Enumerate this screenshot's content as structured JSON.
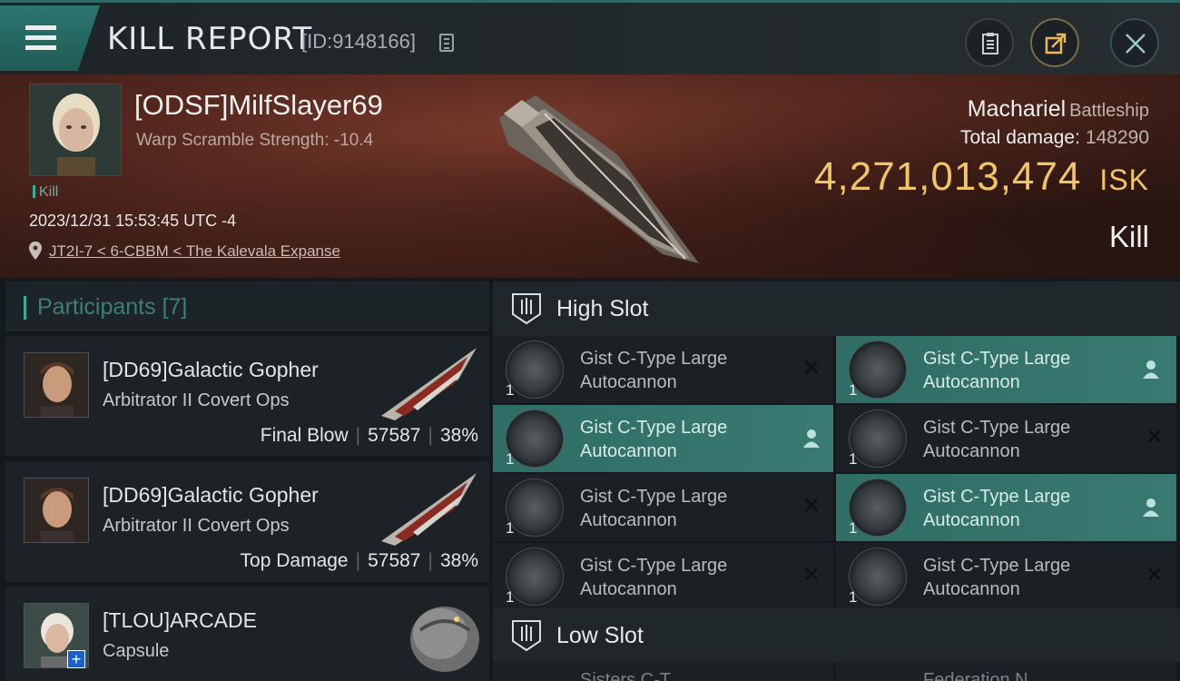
{
  "header": {
    "title": "KILL REPORT",
    "report_id": "[ID:9148166]"
  },
  "victim": {
    "name": "[ODSF]MilfSlayer69",
    "subtitle": "Warp Scramble Strength: -10.4",
    "tag": "Kill",
    "datetime": "2023/12/31 15:53:45 UTC -4",
    "location": "JT2I-7 < 6-CBBM < The Kalevala Expanse",
    "ship_name": "Machariel",
    "ship_class": "Battleship",
    "total_damage_label": "Total damage:",
    "total_damage_value": "148290",
    "isk_value": "4,271,013,474",
    "isk_unit": "ISK",
    "result": "Kill"
  },
  "participants": {
    "title": "Participants",
    "count": "[7]",
    "rows": [
      {
        "name": "[DD69]Galactic Gopher",
        "ship": "Arbitrator II Covert Ops",
        "role": "Final Blow",
        "damage": "57587",
        "percent": "38%"
      },
      {
        "name": "[DD69]Galactic Gopher",
        "ship": "Arbitrator II Covert Ops",
        "role": "Top Damage",
        "damage": "57587",
        "percent": "38%"
      },
      {
        "name": "[TLOU]ARCADE",
        "ship": "Capsule",
        "plus_badge": "+"
      }
    ]
  },
  "slots": {
    "high_slot_label": "High Slot",
    "low_slot_label": "Low Slot",
    "modules": [
      {
        "line1": "Gist C-Type Large",
        "line2": "Autocannon",
        "qty": "1",
        "status": "✕"
      },
      {
        "line1": "Gist C-Type Large",
        "line2": "Autocannon",
        "qty": "1",
        "status": "fitted"
      },
      {
        "line1": "Gist C-Type Large",
        "line2": "Autocannon",
        "qty": "1",
        "status": "fitted"
      },
      {
        "line1": "Gist C-Type Large",
        "line2": "Autocannon",
        "qty": "1",
        "status": "✕"
      },
      {
        "line1": "Gist C-Type Large",
        "line2": "Autocannon",
        "qty": "1",
        "status": "✕"
      },
      {
        "line1": "Gist C-Type Large",
        "line2": "Autocannon",
        "qty": "1",
        "status": "fitted"
      },
      {
        "line1": "Gist C-Type Large",
        "line2": "Autocannon",
        "qty": "1",
        "status": "✕"
      },
      {
        "line1": "Gist C-Type Large",
        "line2": "Autocannon",
        "qty": "1",
        "status": "✕"
      }
    ],
    "low_peek": [
      "Sisters C-T",
      "Federation N"
    ]
  },
  "colors": {
    "accent": "#2fb29c",
    "isk_gold": "#f1c466",
    "fitted_bg": "#387a72"
  }
}
